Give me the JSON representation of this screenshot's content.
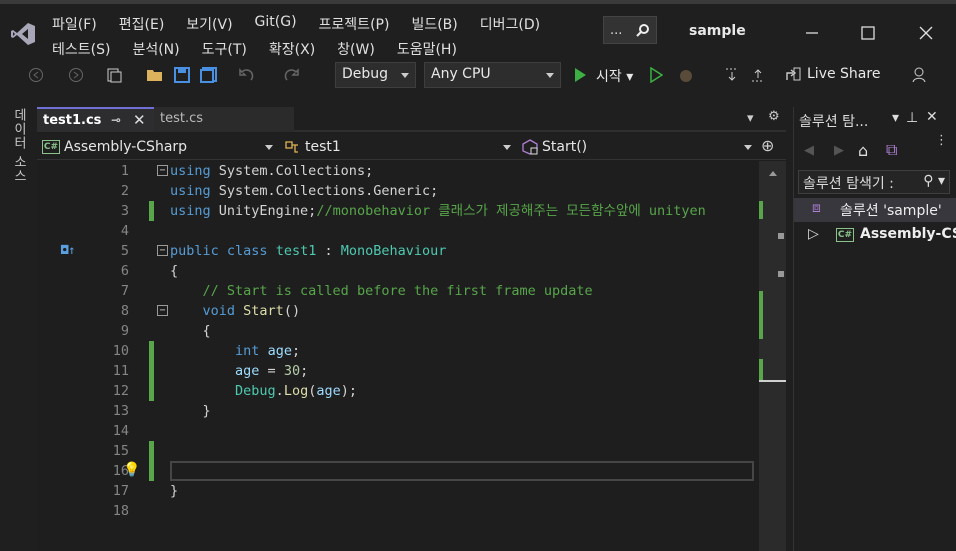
{
  "menu": {
    "row1": [
      "파일(F)",
      "편집(E)",
      "보기(V)",
      "Git(G)",
      "프로젝트(P)",
      "빌드(B)",
      "디버그(D)"
    ],
    "row2": [
      "테스트(S)",
      "분석(N)",
      "도구(T)",
      "확장(X)",
      "창(W)",
      "도움말(H)"
    ]
  },
  "search_dots": "...",
  "solution_title": "sample",
  "toolbar": {
    "config": "Debug",
    "platform": "Any CPU",
    "run_label": "시작",
    "live_share": "Live Share"
  },
  "left_tab": "데이터 소스",
  "tabs": [
    {
      "label": "test1.cs",
      "active": true
    },
    {
      "label": "test.cs",
      "active": false
    }
  ],
  "nav": {
    "project": "Assembly-CSharp",
    "class": "test1",
    "member": "Start()"
  },
  "code_lines": [
    {
      "n": "1",
      "html": "<span class='kw'>using</span> System.Collections;"
    },
    {
      "n": "2",
      "html": "<span class='kw'>using</span> System.Collections.Generic;"
    },
    {
      "n": "3",
      "html": "<span class='kw'>using</span> UnityEngine;<span class='cm'>//monobehavior 클래스가 제공해주는 모든함수앞에 unityen</span>"
    },
    {
      "n": "4",
      "html": ""
    },
    {
      "n": "5",
      "html": "<span class='kw'>public</span> <span class='kw'>class</span> <span class='ty'>test1</span> : <span class='ty'>MonoBehaviour</span>"
    },
    {
      "n": "6",
      "html": "{"
    },
    {
      "n": "7",
      "html": "    <span class='cm'>// Start is called before the first frame update</span>"
    },
    {
      "n": "8",
      "html": "    <span class='kw'>void</span> <span class='fn'>Start</span>()"
    },
    {
      "n": "9",
      "html": "    {"
    },
    {
      "n": "10",
      "html": "        <span class='kw'>int</span> <span class='id'>age</span>;"
    },
    {
      "n": "11",
      "html": "        <span class='id'>age</span> = <span class='nm'>30</span>;"
    },
    {
      "n": "12",
      "html": "        <span class='ty'>Debug</span>.<span class='fn'>Log</span>(<span class='id'>age</span>);"
    },
    {
      "n": "13",
      "html": "    }"
    },
    {
      "n": "14",
      "html": ""
    },
    {
      "n": "15",
      "html": ""
    },
    {
      "n": "16",
      "html": ""
    },
    {
      "n": "17",
      "html": "}"
    },
    {
      "n": "18",
      "html": ""
    }
  ],
  "solution_explorer": {
    "header": "솔루션 탐...",
    "search_placeholder": "솔루션 탐색기 :",
    "root": "솔루션 'sample'",
    "project": "Assembly-CSharp"
  },
  "colors": {
    "accent_green": "#57a64a",
    "keyword": "#569cd6",
    "type": "#4ec9b0"
  }
}
